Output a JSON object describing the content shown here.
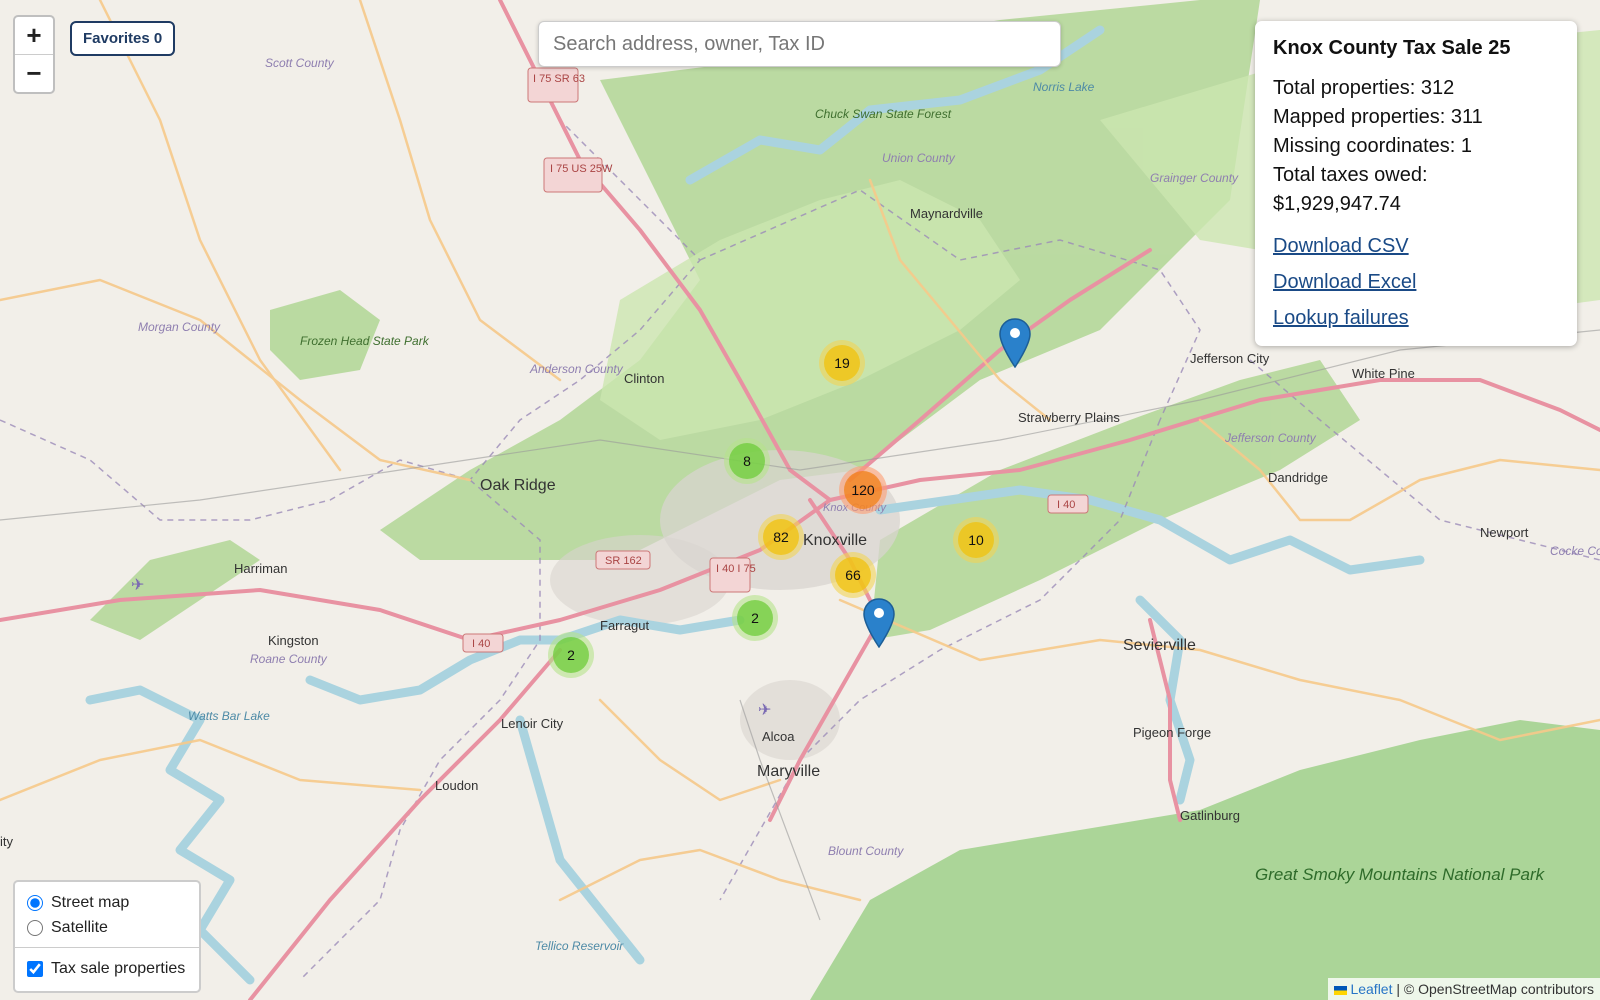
{
  "toolbar": {
    "zoom_in": "+",
    "zoom_out": "−",
    "favorites_label": "Favorites 0"
  },
  "search": {
    "placeholder": "Search address, owner, Tax ID",
    "value": ""
  },
  "info_panel": {
    "title": "Knox County Tax Sale 25",
    "total_properties": "Total properties: 312",
    "mapped_properties": "Mapped properties: 311",
    "missing_coordinates": "Missing coordinates: 1",
    "total_taxes": "Total taxes owed: $1,929,947.74",
    "links": {
      "csv": "Download CSV",
      "excel": "Download Excel",
      "failures": "Lookup failures"
    }
  },
  "layers": {
    "base_options": [
      "Street map",
      "Satellite"
    ],
    "selected_base": "Street map",
    "overlays": [
      {
        "label": "Tax sale properties",
        "checked": true
      }
    ]
  },
  "clusters": [
    {
      "count": "19",
      "tier": "medium"
    },
    {
      "count": "8",
      "tier": "small"
    },
    {
      "count": "120",
      "tier": "large"
    },
    {
      "count": "82",
      "tier": "medium"
    },
    {
      "count": "10",
      "tier": "medium"
    },
    {
      "count": "66",
      "tier": "medium"
    },
    {
      "count": "2",
      "tier": "small"
    },
    {
      "count": "2",
      "tier": "small"
    }
  ],
  "markers": 2,
  "map_labels": {
    "scott_county": "Scott County",
    "morgan_county": "Morgan County",
    "frozen_head": "Frozen Head State Park",
    "anderson_county": "Anderson County",
    "clinton": "Clinton",
    "oak_ridge": "Oak Ridge",
    "harriman": "Harriman",
    "kingston": "Kingston",
    "roane_county": "Roane County",
    "watts_bar": "Watts Bar Lake",
    "loudon": "Loudon",
    "lenoir_city": "Lenoir City",
    "farragut": "Farragut",
    "knoxville": "Knoxville",
    "knox_county": "Knox County",
    "alcoa": "Alcoa",
    "maryville": "Maryville",
    "blount_county": "Blount County",
    "tellico": "Tellico Reservoir",
    "chuck_swan": "Chuck Swan State Forest",
    "union_county": "Union County",
    "norris_lake": "Norris Lake",
    "maynardville": "Maynardville",
    "grainger": "Grainger County",
    "strawberry": "Strawberry Plains",
    "jefferson_city": "Jefferson City",
    "white_pine": "White Pine",
    "jefferson_county": "Jefferson County",
    "dandridge": "Dandridge",
    "newport": "Newport",
    "cocke": "Cocke Co",
    "sevierville": "Sevierville",
    "pigeon_forge": "Pigeon Forge",
    "gatlinburg": "Gatlinburg",
    "smoky": "Great Smoky Mountains National Park",
    "i75_sr63": "I 75 SR 63",
    "i75_us25w": "I 75 US 25W",
    "sr162": "SR 162",
    "i40_i75": "I 40 I 75",
    "i40_west": "I 40",
    "i40_east": "I 40",
    "ity": "ity"
  },
  "attribution": {
    "leaflet": "Leaflet",
    "osm": "| © OpenStreetMap contributors"
  }
}
